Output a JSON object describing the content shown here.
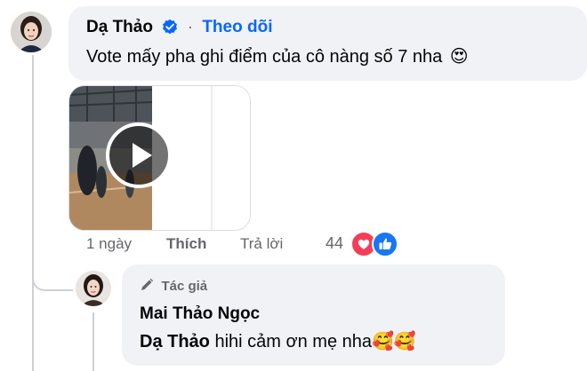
{
  "comment": {
    "author": "Dạ Thảo",
    "follow_label": "Theo dõi",
    "separator": "·",
    "text": "Vote mấy pha ghi điểm của cô nàng số 7 nha",
    "emoji": "😍",
    "time": "1 ngày",
    "like_label": "Thích",
    "reply_label": "Trả lời",
    "reaction_count": "44"
  },
  "reply": {
    "badge_label": "Tác giả",
    "author": "Mai Thảo Ngọc",
    "mention": "Dạ Thảo",
    "text": " hihi cảm ơn mẹ nha",
    "emoji": "🥰🥰"
  },
  "colors": {
    "bubble_bg": "#f0f2f5",
    "link_blue": "#0866ff",
    "love_red": "#f33e58",
    "secondary_text": "#65676b"
  },
  "icons": [
    "verified-icon",
    "play-icon",
    "love-reaction-icon",
    "like-reaction-icon",
    "pencil-icon"
  ]
}
